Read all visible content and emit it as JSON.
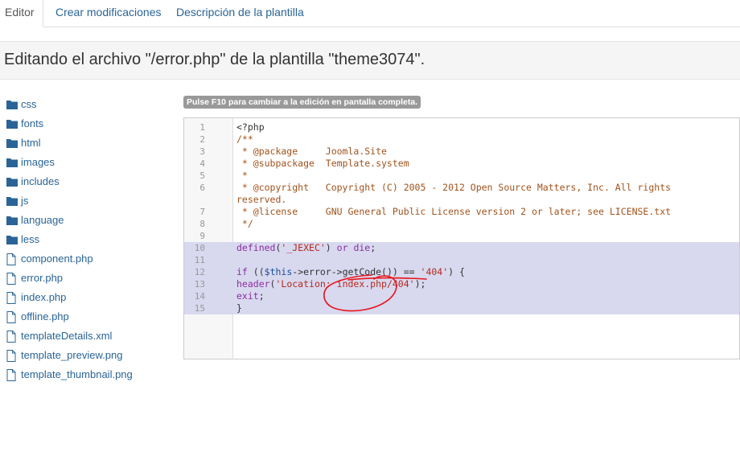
{
  "tabs": [
    {
      "label": "Editor",
      "active": true
    },
    {
      "label": "Crear modificaciones",
      "active": false
    },
    {
      "label": "Descripción de la plantilla",
      "active": false
    }
  ],
  "page_title": "Editando el archivo \"/error.php\" de la plantilla \"theme3074\".",
  "file_tree": {
    "folders": [
      "css",
      "fonts",
      "html",
      "images",
      "includes",
      "js",
      "language",
      "less"
    ],
    "files": [
      "component.php",
      "error.php",
      "index.php",
      "offline.php",
      "templateDetails.xml",
      "template_preview.png",
      "template_thumbnail.png"
    ]
  },
  "notice": "Pulse F10 para cambiar a la edición en pantalla completa.",
  "editor": {
    "line_numbers": [
      "1",
      "2",
      "3",
      "4",
      "5",
      "6",
      "7",
      "8",
      "9",
      "10",
      "11",
      "12",
      "13",
      "14",
      "15"
    ],
    "highlighted_lines": [
      10,
      11,
      12,
      13,
      14,
      15
    ]
  },
  "code": {
    "l1": "<?php",
    "l2": "/**",
    "l3": " * @package     Joomla.Site",
    "l4": " * @subpackage  Template.system",
    "l5": " *",
    "l6a": " * @copyright   Copyright (C) 2005 - 2012 Open Source Matters, Inc. All rights",
    "l6b": "reserved.",
    "l7": " * @license     GNU General Public License version 2 or later; see LICENSE.txt",
    "l8": " */",
    "l10": {
      "kw1": "defined",
      "p1": "(",
      "s1": "'_JEXEC'",
      "p2": ") ",
      "kw2": "or",
      "sp": " ",
      "kw3": "die",
      "p3": ";"
    },
    "l12": {
      "kw1": "if",
      "p1": " ((",
      "v1": "$this",
      "p2": "->error->getCode()) == ",
      "s1": "'404'",
      "p3": ") {"
    },
    "l13": {
      "f1": "header",
      "p1": "(",
      "s1": "'Location: index.php/404'",
      "p2": ");"
    },
    "l14": {
      "kw1": "exit",
      "p1": ";"
    },
    "l15": "}"
  },
  "colors": {
    "link": "#2a6496",
    "highlight": "#d8d8ef",
    "annotation": "#e8141b"
  }
}
